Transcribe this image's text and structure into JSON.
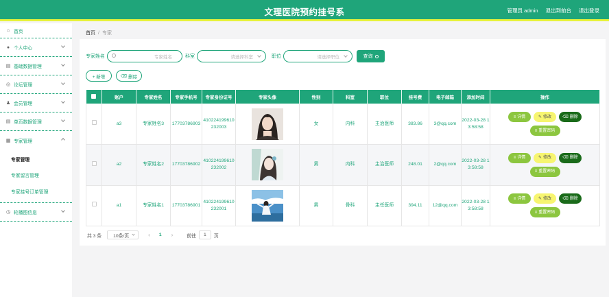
{
  "header": {
    "title": "文理医院预约挂号系",
    "user": "管理员 admin",
    "exit_front": "退出到前台",
    "logout": "退出登录"
  },
  "sidebar": {
    "items": [
      {
        "label": "首页",
        "icon": "home-icon"
      },
      {
        "label": "个人中心",
        "icon": "user-icon"
      },
      {
        "label": "基础数据管理",
        "icon": "database-icon"
      },
      {
        "label": "论坛管理",
        "icon": "forum-icon"
      },
      {
        "label": "会员管理",
        "icon": "member-icon"
      },
      {
        "label": "单页数据管理",
        "icon": "page-icon"
      },
      {
        "label": "专家管理",
        "icon": "doctor-icon"
      },
      {
        "label": "轮播图信息",
        "icon": "carousel-icon"
      }
    ],
    "sub_items": [
      "专家管理",
      "专家留言管理",
      "专家挂号订单管理"
    ]
  },
  "breadcrumb": {
    "home": "首页",
    "sep": "/",
    "current": "专家"
  },
  "search": {
    "name_label": "专家姓名",
    "name_placeholder": "专家姓名",
    "dept_label": "科室",
    "dept_placeholder": "请选择科室",
    "title_label": "职位",
    "title_placeholder": "请选择职位",
    "query_label": "查询"
  },
  "actions": {
    "add_label": "+ 新增",
    "delete_label": "删除"
  },
  "table": {
    "columns": [
      "账户",
      "专家姓名",
      "专家手机号",
      "专家身份证号",
      "专家头像",
      "性别",
      "科室",
      "职位",
      "挂号费",
      "电子邮箱",
      "添加时间",
      "操作"
    ],
    "rows": [
      {
        "account": "a3",
        "name": "专家姓名3",
        "phone": "17703786903",
        "idcard": "410224199610232003",
        "gender": "女",
        "dept": "内科",
        "title": "主治医师",
        "fee": "383.86",
        "email": "3@qq.com",
        "time": "2022-03-28 13:58:58"
      },
      {
        "account": "a2",
        "name": "专家姓名2",
        "phone": "17703786902",
        "idcard": "410224199610232002",
        "gender": "男",
        "dept": "内科",
        "title": "主治医师",
        "fee": "248.01",
        "email": "2@qq.com",
        "time": "2022-03-28 13:58:58"
      },
      {
        "account": "a1",
        "name": "专家姓名1",
        "phone": "17703786901",
        "idcard": "410224199610232001",
        "gender": "男",
        "dept": "骨科",
        "title": "主任医师",
        "fee": "394.11",
        "email": "12@qq.com",
        "time": "2022-03-28 13:58:58"
      }
    ],
    "ops": {
      "detail": "详情",
      "edit": "修改",
      "del": "删除",
      "reset": "重置密码"
    }
  },
  "pager": {
    "total": "共 3 条",
    "size": "10条/页",
    "prev": "‹",
    "page": "1",
    "next": "›",
    "goto_label": "前往",
    "goto_value": "1",
    "unit": "页"
  },
  "colors": {
    "primary": "#1fa57a",
    "accent": "#e8f23a",
    "detail": "#8cc63f",
    "edit": "#f7f570",
    "del": "#1a6b1a"
  }
}
